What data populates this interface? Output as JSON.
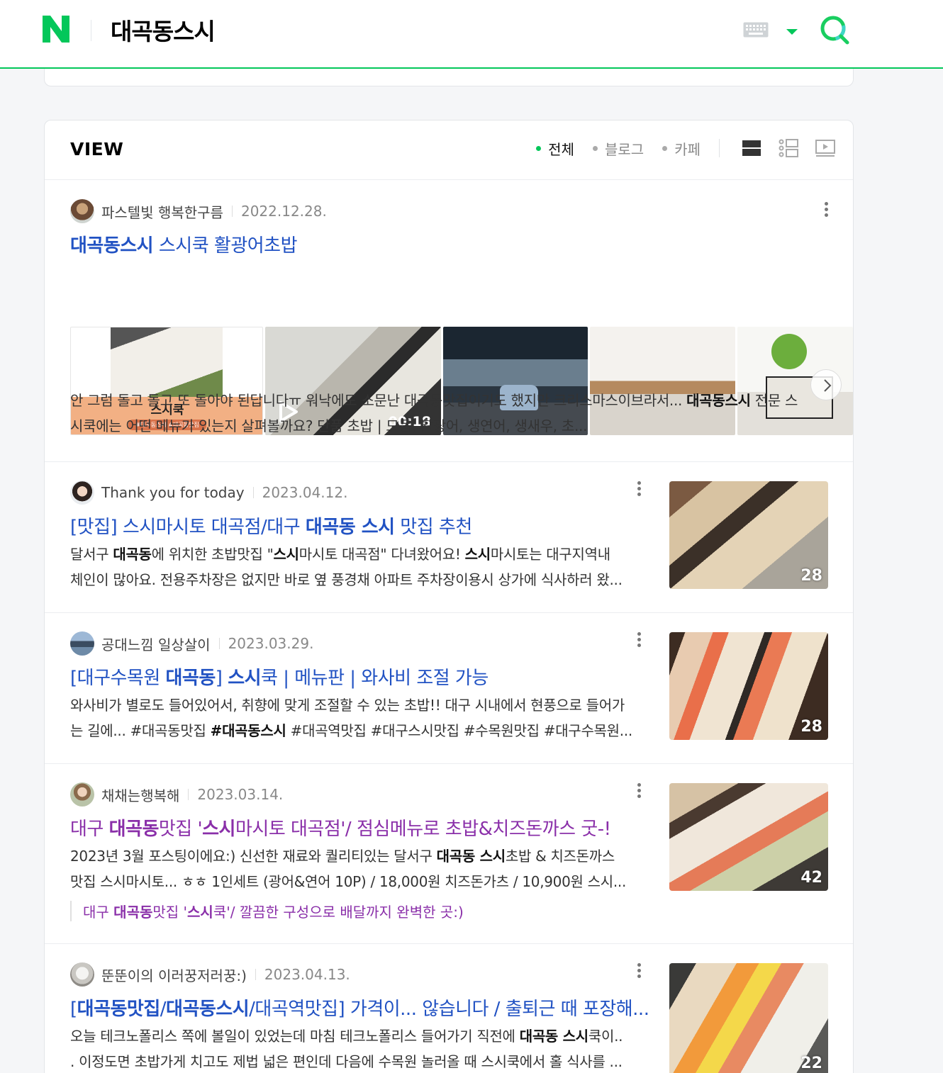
{
  "header": {
    "logo_letter": "N",
    "query": "대곡동스시",
    "colors": {
      "brand_green": "#03c75a",
      "link_blue": "#2152c3",
      "visited_purple": "#8a2fa9"
    }
  },
  "view": {
    "title": "VIEW",
    "filters": [
      {
        "label": "전체",
        "active": true
      },
      {
        "label": "블로그",
        "active": false
      },
      {
        "label": "카페",
        "active": false
      }
    ],
    "layout_icons": [
      "list-layout-icon",
      "compact-layout-icon",
      "video-layout-icon"
    ]
  },
  "items": [
    {
      "author": "파스텔빛 행복한구름",
      "date": "2022.12.28.",
      "title_bold": "대곡동스시",
      "title_rest": " 스시쿡 활광어초밥",
      "gallery": {
        "label": "스시쿡",
        "tags": "#대곡동스시 #대곡동맛집",
        "video_time": "00:18"
      },
      "desc_1": "안 그럼 돌고 돌고 또 돌아야 된답니다ㅠ 워낙에도 소문난 대곡동맛집이기도 했지만 크리스마스이브라서... ",
      "desc_bold": "대곡동스시",
      "desc_2": " 전문 스",
      "desc_3": "시쿡에는 어떤 메뉴가 있는지 살펴볼까요? 단품 초밥 | 모듬, 활광어, 생연어, 생새우, 초..."
    },
    {
      "author": "Thank you for today",
      "date": "2023.04.12.",
      "t1": "[맛집] 스시마시토 대곡점/대구 ",
      "t2": "대곡동 스시",
      "t3": " 맛집 추천",
      "d1a": "달서구 ",
      "d1b": "대곡동",
      "d1c": "에 위치한 초밥맛집 \"",
      "d1d": "스시",
      "d1e": "마시토 대곡점\" 다녀왔어요! ",
      "d1f": "스시",
      "d1g": "마시토는 대구지역내",
      "d2": "체인이 많아요. 전용주차장은 없지만 바로 옆 풍경채 아파트 주차장이용시 상가에 식사하러 왔...",
      "count": "28"
    },
    {
      "author": "공대느낌 일상살이",
      "date": "2023.03.29.",
      "t1": "[대구수목원 ",
      "t2": "대곡동",
      "t3": "] ",
      "t4": "스시",
      "t5": "쿡 | 메뉴판 | 와사비 조절 가능",
      "d1": "와사비가 별로도 들어있어서, 취향에 맞게 조절할 수 있는 초밥!! 대구 시내에서 현풍으로 들어가",
      "d2a": "는 길에... #대곡동맛집 ",
      "d2b": "#대곡동스시",
      "d2c": " #대곡역맛집 #대구스시맛집 #수목원맛집 #대구수목원...",
      "count": "28"
    },
    {
      "author": "채채는행복해",
      "date": "2023.03.14.",
      "t1": "대구 ",
      "t2": "대곡동",
      "t3": "맛집 '",
      "t4": "스시",
      "t5": "마시토 대곡점'/ 점심메뉴로 초밥&치즈돈까스 굿-!",
      "d1a": "2023년 3월 포스팅이에요:) 신선한 재료와 퀄리티있는 달서구 ",
      "d1b": "대곡동 스시",
      "d1c": "초밥 & 치즈돈까스",
      "d2": "맛집 스시마시토... ㅎㅎ 1인세트 (광어&연어 10P) / 18,000원 치즈돈가츠 / 10,900원 스시...",
      "r1": "대구 ",
      "r2": "대곡동",
      "r3": "맛집 '",
      "r4": "스시",
      "r5": "쿡'/ 깔끔한 구성으로 배달까지 완벽한 곳:)",
      "count": "42"
    },
    {
      "author": "뚠뚠이의 이러꿍저러꿍:)",
      "date": "2023.04.13.",
      "t1": "[",
      "t2": "대곡동맛집",
      "t3": "/",
      "t4": "대곡동스시",
      "t5": "/대곡역맛집] 가격이... 않습니다 / 출퇴근 때 포장해...",
      "d1a": "오늘 테크노폴리스 쪽에 볼일이 있었는데 마침 테크노폴리스 들어가기 직전에 ",
      "d1b": "대곡동 스시",
      "d1c": "쿡이..",
      "d2": ". 이정도면 초밥가게 치고도 제법 넓은 편인데 다음에 수목원 놀러올 때 스시쿡에서 홀 식사를 ...",
      "count": "22"
    }
  ]
}
